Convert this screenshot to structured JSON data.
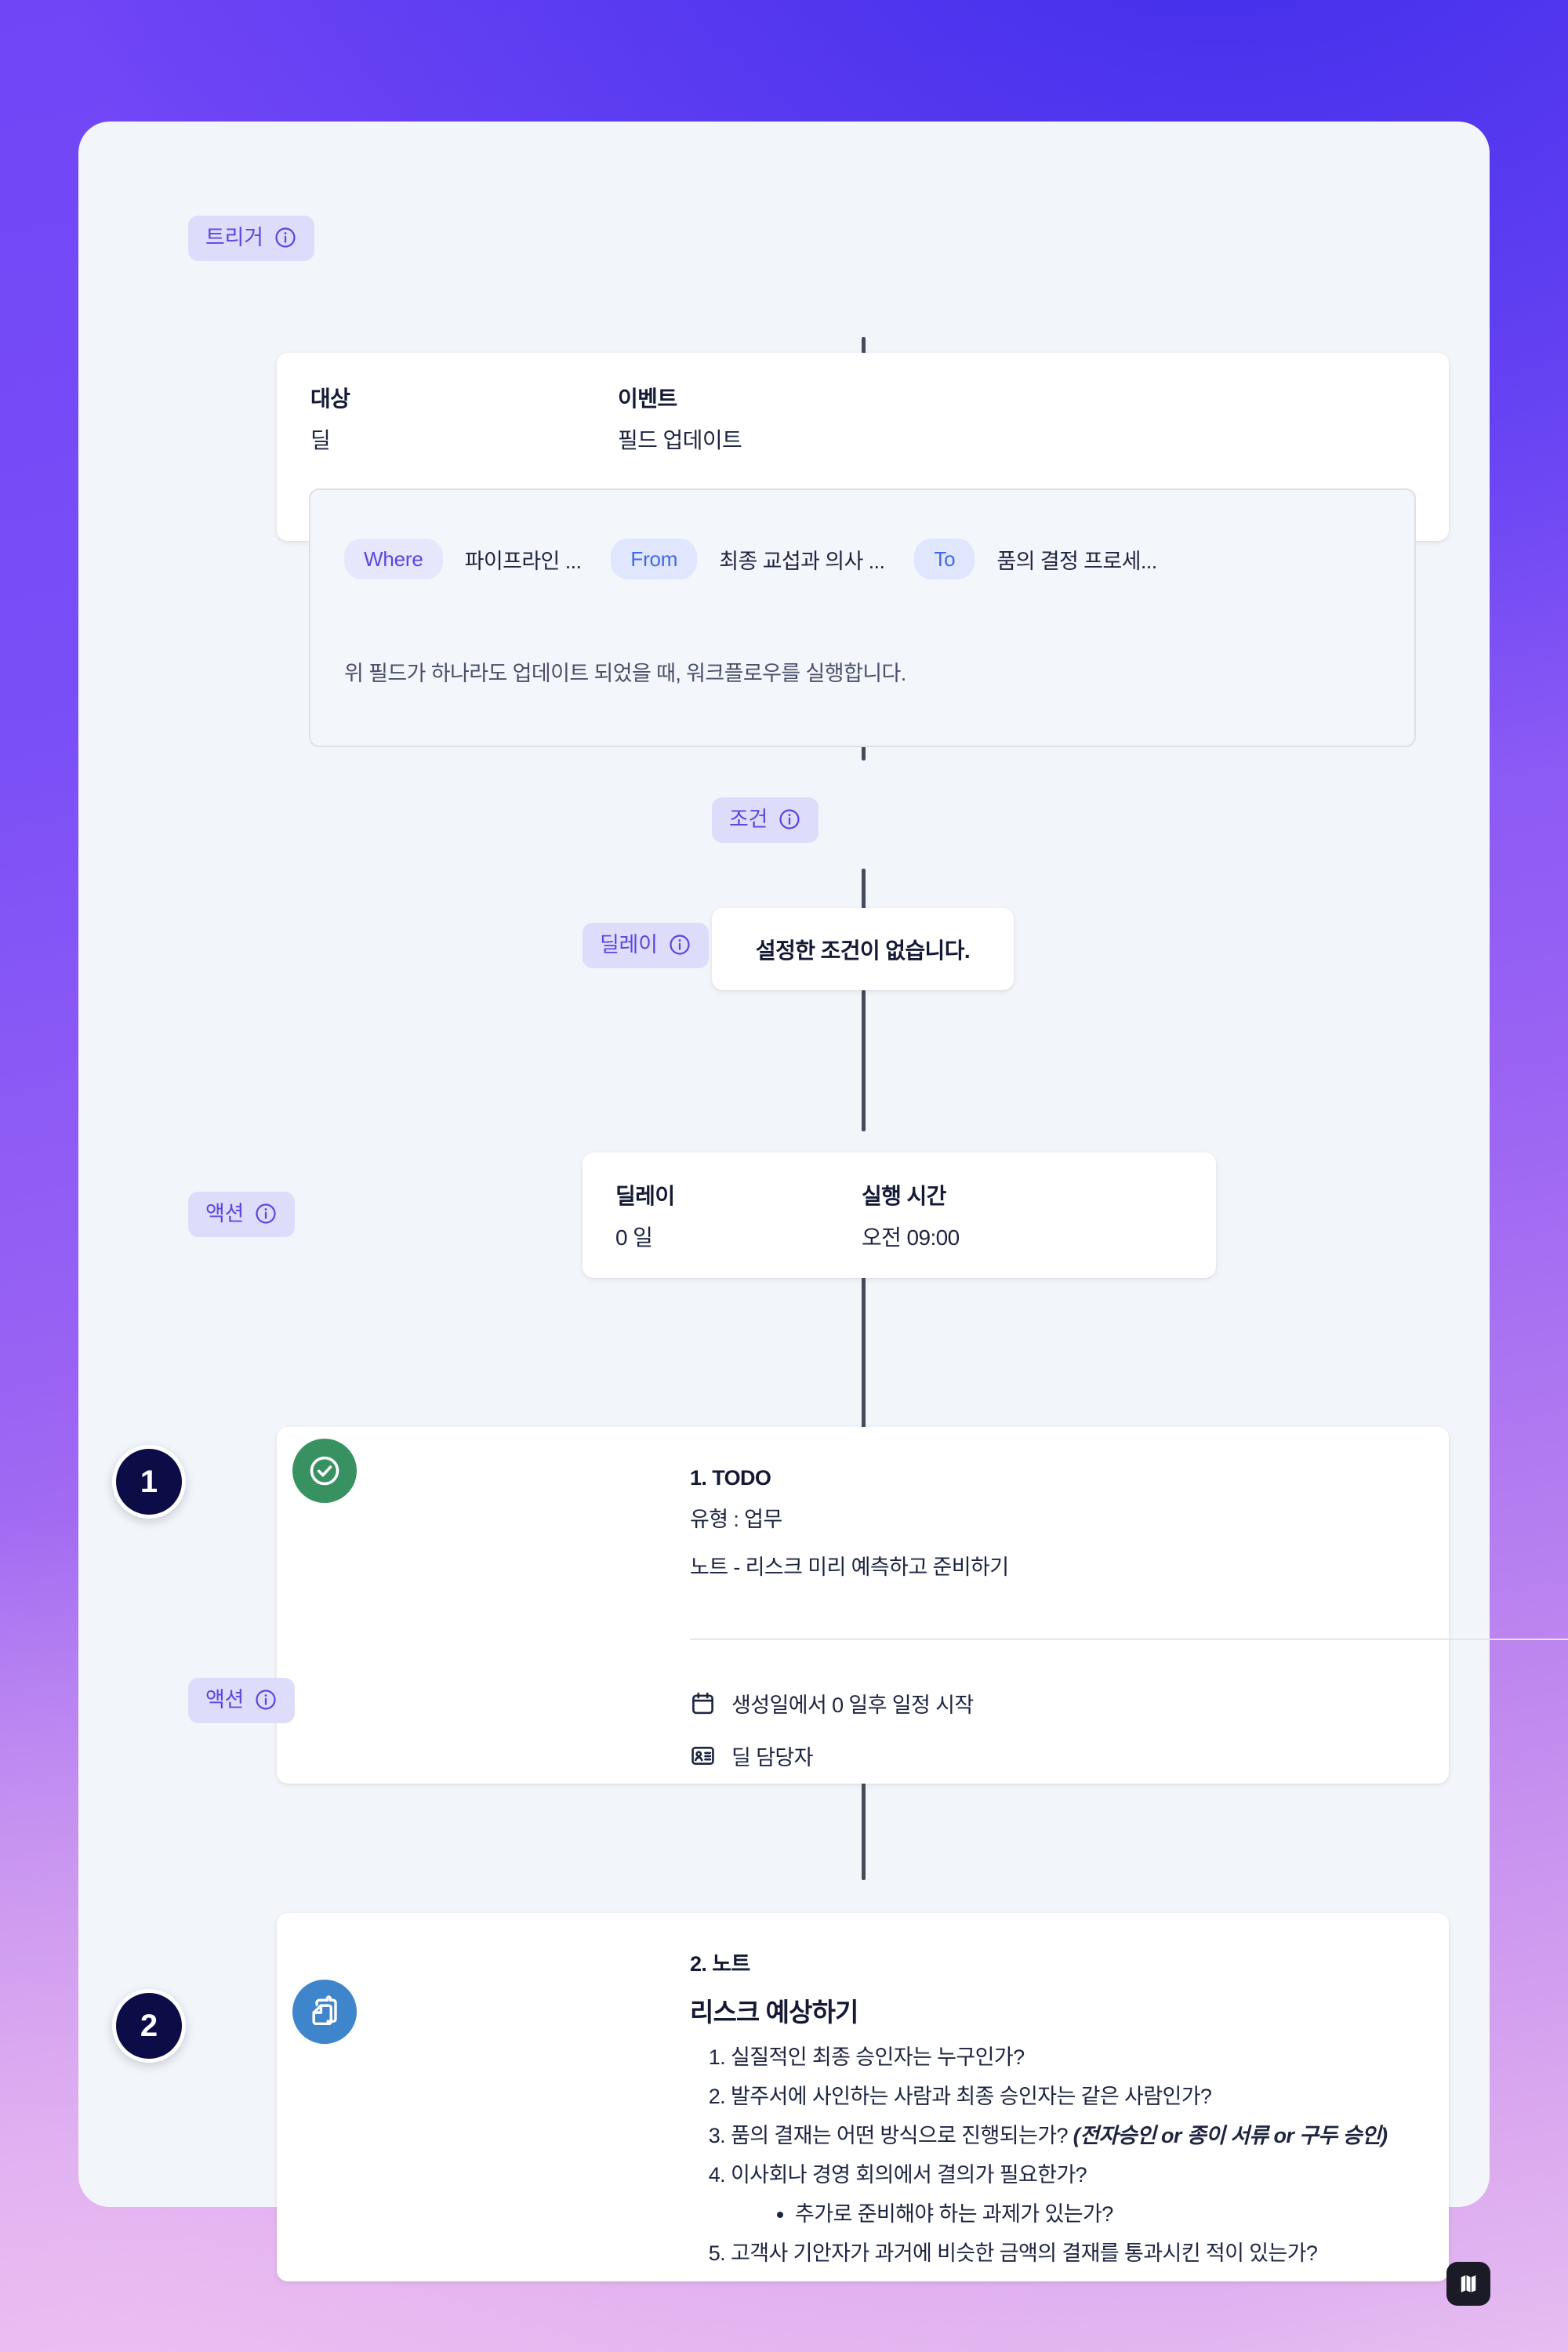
{
  "trigger": {
    "chip_label": "트리거",
    "target_key": "대상",
    "target_value": "딜",
    "event_key": "이벤트",
    "event_value": "필드 업데이트",
    "condition": {
      "where_label": "Where",
      "where_value": "파이프라인 ...",
      "from_label": "From",
      "from_value": "최종 교섭과 의사 ...",
      "to_label": "To",
      "to_value": "품의 결정 프로세...",
      "note": "위 필드가 하나라도 업데이트 되었을 때, 워크플로우를 실행합니다."
    }
  },
  "condition": {
    "chip_label": "조건",
    "empty_text": "설정한 조건이 없습니다."
  },
  "delay": {
    "chip_label": "딜레이",
    "delay_key": "딜레이",
    "delay_value": "0 일",
    "time_key": "실행 시간",
    "time_value": "오전 09:00"
  },
  "actions": [
    {
      "chip_label": "액션",
      "badge": "1",
      "icon": "check-circle-icon",
      "icon_color": "#389161",
      "index_label": "1. TODO",
      "type_label": "유형 : 업무",
      "title": "노트 - 리스크 미리 예측하고 준비하기",
      "meta": [
        {
          "icon": "calendar-icon",
          "text": "생성일에서 0 일후 일정 시작"
        },
        {
          "icon": "contact-card-icon",
          "text": "딜 담당자"
        }
      ]
    },
    {
      "chip_label": "액션",
      "badge": "2",
      "icon": "clipboard-note-icon",
      "icon_color": "#3e85cb",
      "index_label": "2. 노트",
      "heading": "리스크 예상하기",
      "questions": [
        {
          "text": "실질적인 최종 승인자는 누구인가?"
        },
        {
          "text": "발주서에 사인하는 사람과 최종 승인자는 같은 사람인가?"
        },
        {
          "text": "품의 결재는 어떤 방식으로 진행되는가? ",
          "emphasis": "(전자승인 or 종이 서류 or 구두 승인)"
        },
        {
          "text": "이사회나 경영 회의에서 결의가 필요한가?",
          "sub": [
            "추가로 준비해야 하는 과제가 있는가?"
          ]
        },
        {
          "text": "고객사 기안자가 과거에 비슷한 금액의 결재를 통과시킨 적이 있는가?"
        }
      ]
    }
  ],
  "logo": {
    "name": "app-logo",
    "glyph": "folded-map-icon"
  },
  "colors": {
    "chip_bg": "#dedcfb",
    "chip_text": "#5b46e0",
    "spine": "#454b5c",
    "panel_bg": "#f2f5f9",
    "badge_bg": "#0c0c46",
    "action1_icon": "#389161",
    "action2_icon": "#3e85cb",
    "pill_where_bg": "#e6e6fd",
    "pill_where_text": "#5b46e0",
    "pill_fromto_bg": "#dfe6fd",
    "pill_fromto_text": "#3f6ae8"
  }
}
